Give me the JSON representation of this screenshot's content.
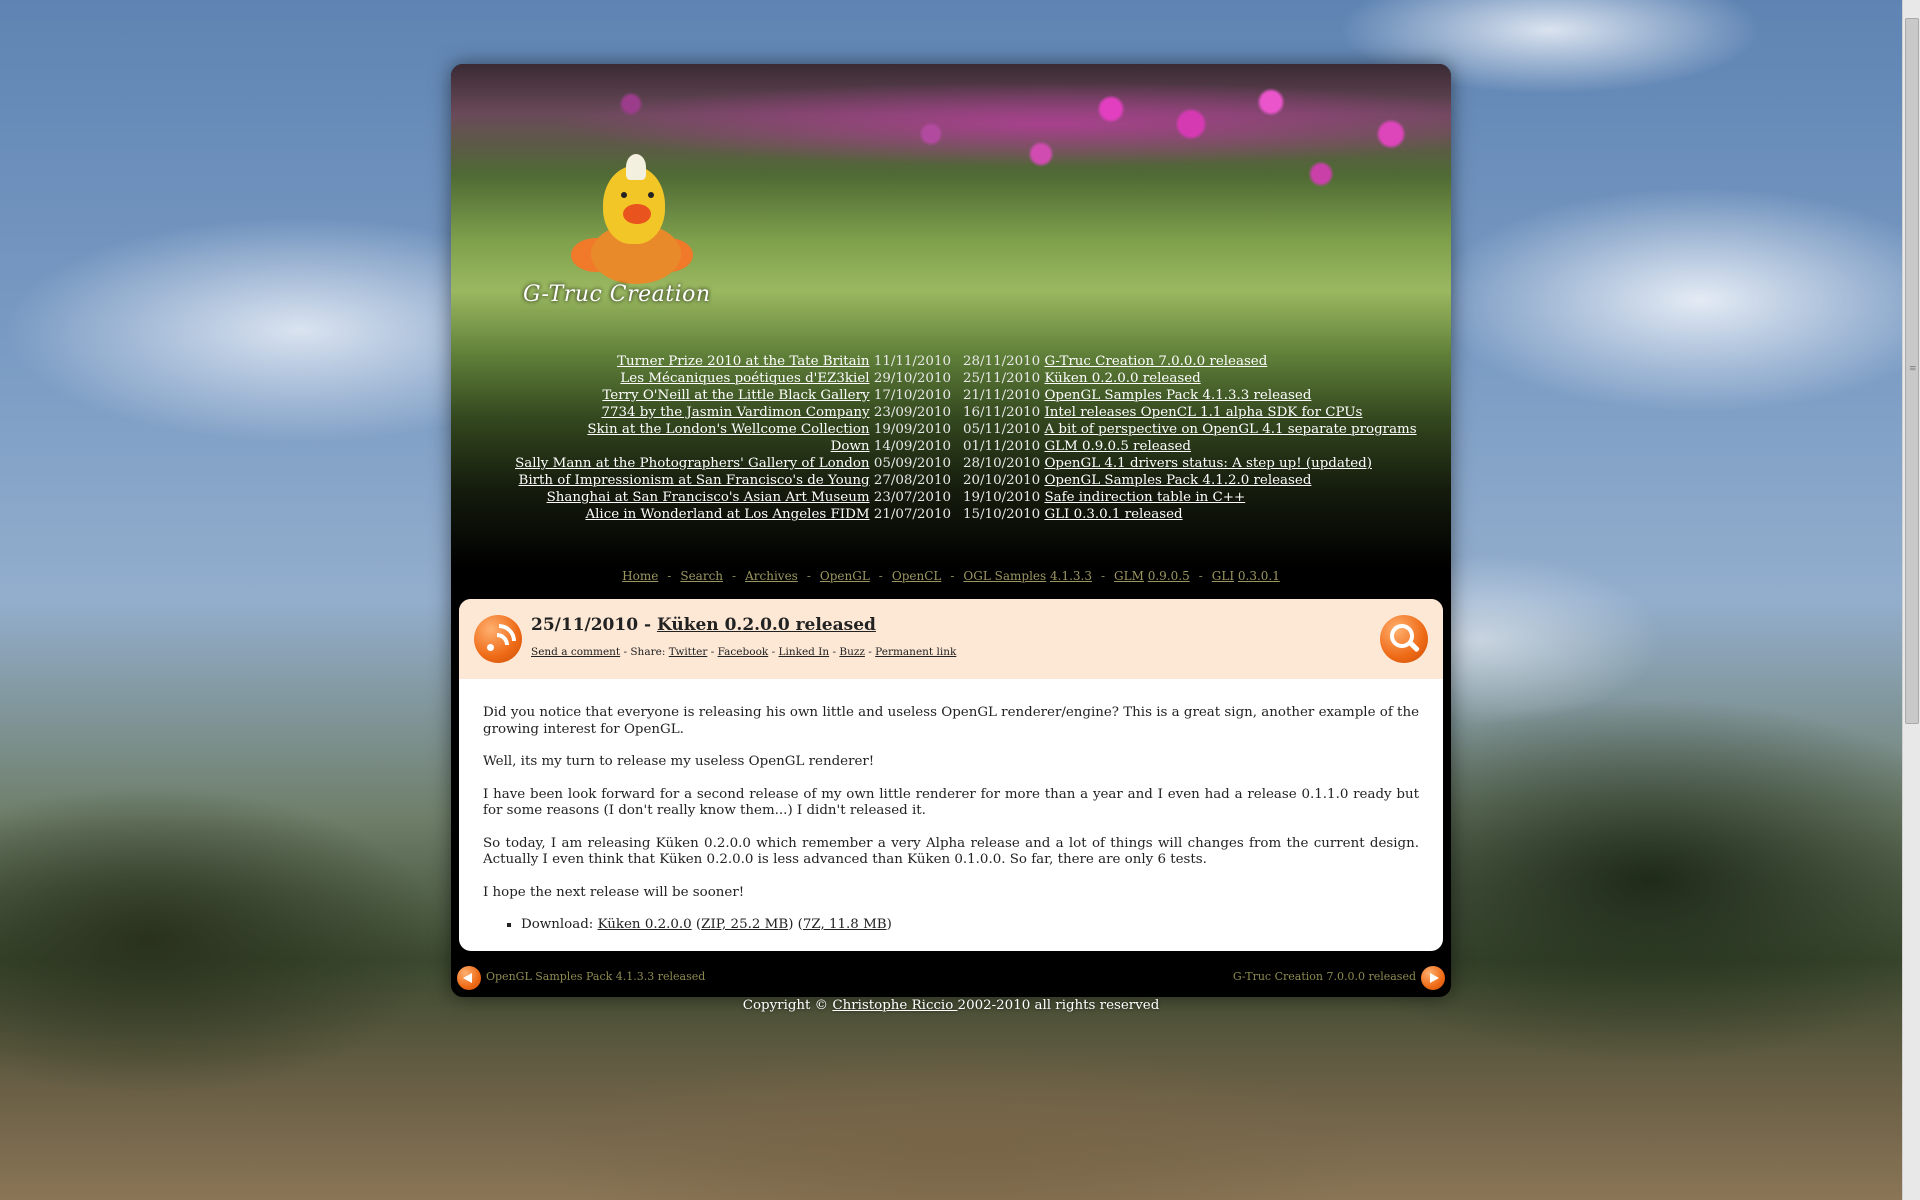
{
  "site": {
    "logo": "G-Truc Creation"
  },
  "left_list": [
    {
      "title": "Turner Prize 2010 at the Tate Britain",
      "date": "11/11/2010"
    },
    {
      "title": "Les Mécaniques poétiques d'EZ3kiel",
      "date": "29/10/2010"
    },
    {
      "title": "Terry O'Neill at the Little Black Gallery",
      "date": "17/10/2010"
    },
    {
      "title": "7734 by the Jasmin Vardimon Company",
      "date": "23/09/2010"
    },
    {
      "title": "Skin at the London's Wellcome Collection",
      "date": "19/09/2010"
    },
    {
      "title": "Down",
      "date": "14/09/2010"
    },
    {
      "title": "Sally Mann at the Photographers' Gallery of London",
      "date": "05/09/2010"
    },
    {
      "title": "Birth of Impressionism at San Francisco's de Young",
      "date": "27/08/2010"
    },
    {
      "title": "Shanghai at San Francisco's Asian Art Museum",
      "date": "23/07/2010"
    },
    {
      "title": "Alice in Wonderland at Los Angeles FIDM",
      "date": "21/07/2010"
    }
  ],
  "right_list": [
    {
      "date": "28/11/2010",
      "title": "G-Truc Creation 7.0.0.0 released"
    },
    {
      "date": "25/11/2010",
      "title": "Küken 0.2.0.0 released"
    },
    {
      "date": "21/11/2010",
      "title": "OpenGL Samples Pack 4.1.3.3 released"
    },
    {
      "date": "16/11/2010",
      "title": "Intel releases OpenCL 1.1 alpha SDK for CPUs"
    },
    {
      "date": "05/11/2010",
      "title": "A bit of perspective on OpenGL 4.1 separate programs"
    },
    {
      "date": "01/11/2010",
      "title": "GLM 0.9.0.5 released"
    },
    {
      "date": "28/10/2010",
      "title": "OpenGL 4.1 drivers status: A step up! (updated)"
    },
    {
      "date": "20/10/2010",
      "title": "OpenGL Samples Pack 4.1.2.0 released"
    },
    {
      "date": "19/10/2010",
      "title": "Safe indirection table in C++"
    },
    {
      "date": "15/10/2010",
      "title": "GLI 0.3.0.1 released"
    }
  ],
  "menu": {
    "home": "Home",
    "search": "Search",
    "archives": "Archives",
    "opengl": "OpenGL",
    "opencl": "OpenCL",
    "ogl_samples": "OGL Samples",
    "ogl_samples_ver": "4.1.3.3",
    "glm": "GLM",
    "glm_ver": "0.9.0.5",
    "gli": "GLI",
    "gli_ver": "0.3.0.1",
    "separator": "-"
  },
  "post": {
    "date_prefix": "25/11/2010 - ",
    "title": "Küken 0.2.0.0 released",
    "meta": {
      "send_comment": "Send a comment",
      "share_label": " - Share: ",
      "twitter": "Twitter",
      "facebook": "Facebook",
      "linkedin": "Linked In",
      "buzz": "Buzz",
      "permalink": "Permanent link",
      "sep": " - "
    },
    "paragraphs": [
      "Did you notice that everyone is releasing his own little and useless OpenGL renderer/engine? This is a great sign, another example of the growing interest for OpenGL.",
      "Well, its my turn to release my useless OpenGL renderer!",
      "I have been look forward for a second release of my own little renderer for more than a year and I even had a release 0.1.1.0 ready but for some reasons (I don't really know them...) I didn't released it.",
      "So today, I am releasing Küken 0.2.0.0 which remember a very Alpha release and a lot of things will changes from the current design. Actually I even think that Küken 0.2.0.0 is less advanced than Küken 0.1.0.0. So far, there are only 6 tests.",
      "I hope the next release will be sooner!"
    ],
    "download": {
      "label": "Download: ",
      "name": "Küken 0.2.0.0",
      "zip": "ZIP, 25.2 MB",
      "sevenz": "7Z, 11.8 MB",
      "open": " (",
      "close": ")",
      "mid": ") ("
    }
  },
  "nav": {
    "prev": "OpenGL Samples Pack 4.1.3.3 released",
    "next": "G-Truc Creation 7.0.0.0 released"
  },
  "footer": {
    "prefix": "Copyright © ",
    "author": "Christophe Riccio ",
    "suffix": "2002-2010 all rights reserved"
  }
}
